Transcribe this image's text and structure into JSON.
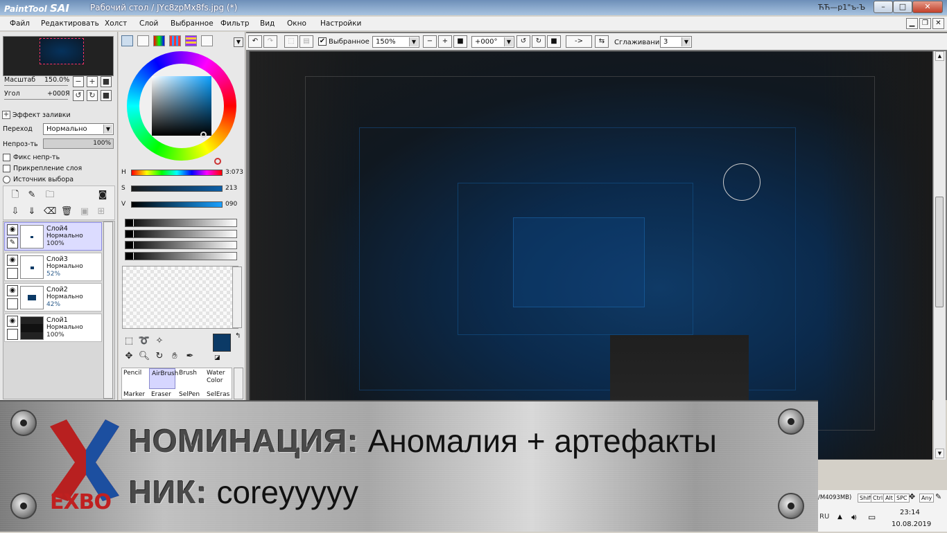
{
  "window": {
    "logo_small": "PaintTool",
    "logo_big": "SAI",
    "title": "Рабочий стол / JYc8zpMx8fs.jpg (*)",
    "user": "ЋЋ—p1\"ъ-Ъ",
    "minimize": "–",
    "maximize": "□",
    "close": "✕"
  },
  "menu": [
    "Файл",
    "Редактировать",
    "Холст",
    "Слой",
    "Выбранное",
    "Фильтр",
    "Вид",
    "Окно",
    "Настройки"
  ],
  "navigator": {
    "zoom_label": "Масштаб",
    "zoom_value": "150.0%",
    "angle_label": "Угол",
    "angle_value": "+000Я"
  },
  "layer_props": {
    "effect_label": "Эффект заливки",
    "blend_label": "Переход",
    "blend_value": "Нормально",
    "opacity_label": "Непроз-ть",
    "opacity_value": "100%",
    "opacity_level": 100,
    "check_preserve": "Фикс непр-ть",
    "check_clip": "Прикрепление слоя",
    "radio_source": "Источник выбора"
  },
  "layers": [
    {
      "name": "Слой4",
      "mode": "Нормально",
      "opacity": "100%",
      "selected": true
    },
    {
      "name": "Слой3",
      "mode": "Нормально",
      "opacity": "52%",
      "selected": false
    },
    {
      "name": "Слой2",
      "mode": "Нормально",
      "opacity": "42%",
      "selected": false
    },
    {
      "name": "Слой1",
      "mode": "Нормально",
      "opacity": "100%",
      "selected": false
    }
  ],
  "color": {
    "h_label": "H",
    "h_value": "3:073",
    "s_label": "S",
    "s_value": "213",
    "v_label": "V",
    "v_value": "090",
    "primary": "#0b3a66",
    "secondary": "#ffffff"
  },
  "tools": {
    "brushes": [
      {
        "l1": "Pencil",
        "l2": ""
      },
      {
        "l1": "AirBrush",
        "l2": ""
      },
      {
        "l1": "Brush",
        "l2": ""
      },
      {
        "l1": "Water",
        "l2": "Color"
      }
    ],
    "brushes_row2": [
      "Marker",
      "Eraser",
      "SelPen",
      "SelEras"
    ]
  },
  "canvas_toolbar": {
    "selection_label": "Выбранное",
    "zoom": "150%",
    "angle": "+000°",
    "arrow": "->",
    "smoothing_label": "Сглаживание",
    "smoothing_value": "3"
  },
  "banner": {
    "logo": "EXBO",
    "line1_key": "НОМИНАЦИЯ:",
    "line1_val": "Аномалия + артефакты",
    "line2_key": "НИК:",
    "line2_val": "coreyyyyy"
  },
  "status": {
    "memory": "/M4093MB)",
    "keys": [
      "Shift",
      "Ctrl",
      "Alt",
      "SPC",
      "Any"
    ],
    "lang": "RU",
    "time": "23:14",
    "date": "10.08.2019"
  }
}
